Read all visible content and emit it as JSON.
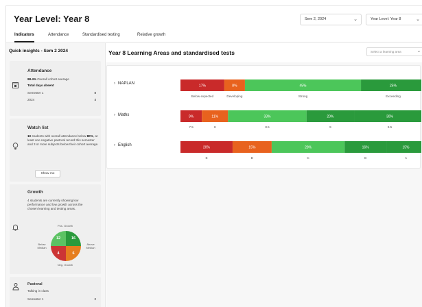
{
  "header": {
    "title": "Year Level: Year 8",
    "semester_select": "Sem 2, 2024",
    "year_select": "Year Level: Year 8"
  },
  "tabs": [
    {
      "label": "Indicators",
      "active": true
    },
    {
      "label": "Attendance",
      "active": false
    },
    {
      "label": "Standardised testing",
      "active": false
    },
    {
      "label": "Relative growth",
      "active": false
    }
  ],
  "sidebar": {
    "title": "Quick insights - Sem 2 2024",
    "attendance": {
      "title": "Attendance",
      "avg_value": "98.4%",
      "avg_label": " Overall cohort average",
      "days_absent_label": "Total days absent",
      "rows": [
        {
          "label": "Semester 1",
          "value": "8"
        },
        {
          "label": "2024",
          "value": "4"
        }
      ]
    },
    "watch_list": {
      "title": "Watch list",
      "count": "10",
      "text_a": " students with overall attendance below ",
      "threshold": "80%",
      "text_b": ", at least one negative pastoral record this semester and 3 or more subjects below their cohort average.",
      "button": "Show me"
    },
    "growth": {
      "title": "Growth",
      "text": "4 students are currently showing low performance and low growth across the chosen learning and testing areas.",
      "quadrants": {
        "top_left": "12",
        "top_right": "16",
        "bottom_left": "4",
        "bottom_right": "6"
      },
      "labels": {
        "top": "Pos. Growth",
        "bottom": "Neg. Growth",
        "left": "Below\nMedian",
        "right": "Above\nMedian"
      }
    },
    "pastoral": {
      "title": "Pastoral",
      "subtitle": "Talking in class",
      "row_label": "Semester 1",
      "row_value": "2"
    }
  },
  "main": {
    "title": "Year 8 Learning Areas and standardised tests",
    "learning_area_placeholder": "Select a learning area"
  },
  "colors": {
    "red": "#c92a2a",
    "orange": "#e8621e",
    "light_green": "#4cc65a",
    "dark_green": "#2a9a3c"
  },
  "chart_data": {
    "type": "bar",
    "orientation": "horizontal-stacked-100",
    "rows": [
      {
        "name": "NAPLAN",
        "segments": [
          {
            "category": "Below expected",
            "value": 17,
            "label": "17%",
            "color": "#c92a2a"
          },
          {
            "category": "Developing",
            "value": 8,
            "label": "8%",
            "color": "#e8621e"
          },
          {
            "category": "Strong",
            "value": 45,
            "label": "45%",
            "color": "#4cc65a"
          },
          {
            "category": "Exceeding",
            "value": 25,
            "label": "25%",
            "color": "#2a9a3c"
          }
        ]
      },
      {
        "name": "Maths",
        "segments": [
          {
            "category": "7.5",
            "value": 9,
            "label": "9%",
            "color": "#c92a2a"
          },
          {
            "category": "8",
            "value": 11,
            "label": "11%",
            "color": "#e8621e"
          },
          {
            "category": "8.5",
            "value": 33,
            "label": "33%",
            "color": "#4cc65a"
          },
          {
            "category": "9",
            "value": 20,
            "label": "20%",
            "color": "#2a9a3c"
          },
          {
            "category": "9.5",
            "value": 30,
            "label": "30%",
            "color": "#2a9a3c"
          }
        ]
      },
      {
        "name": "English",
        "segments": [
          {
            "category": "E",
            "value": 20,
            "label": "20%",
            "color": "#c92a2a"
          },
          {
            "category": "D",
            "value": 15,
            "label": "15%",
            "color": "#e8621e"
          },
          {
            "category": "C",
            "value": 28,
            "label": "28%",
            "color": "#4cc65a"
          },
          {
            "category": "B",
            "value": 16,
            "label": "16%",
            "color": "#2a9a3c"
          },
          {
            "category": "A",
            "value": 15,
            "label": "15%",
            "color": "#2a9a3c"
          }
        ]
      }
    ]
  }
}
